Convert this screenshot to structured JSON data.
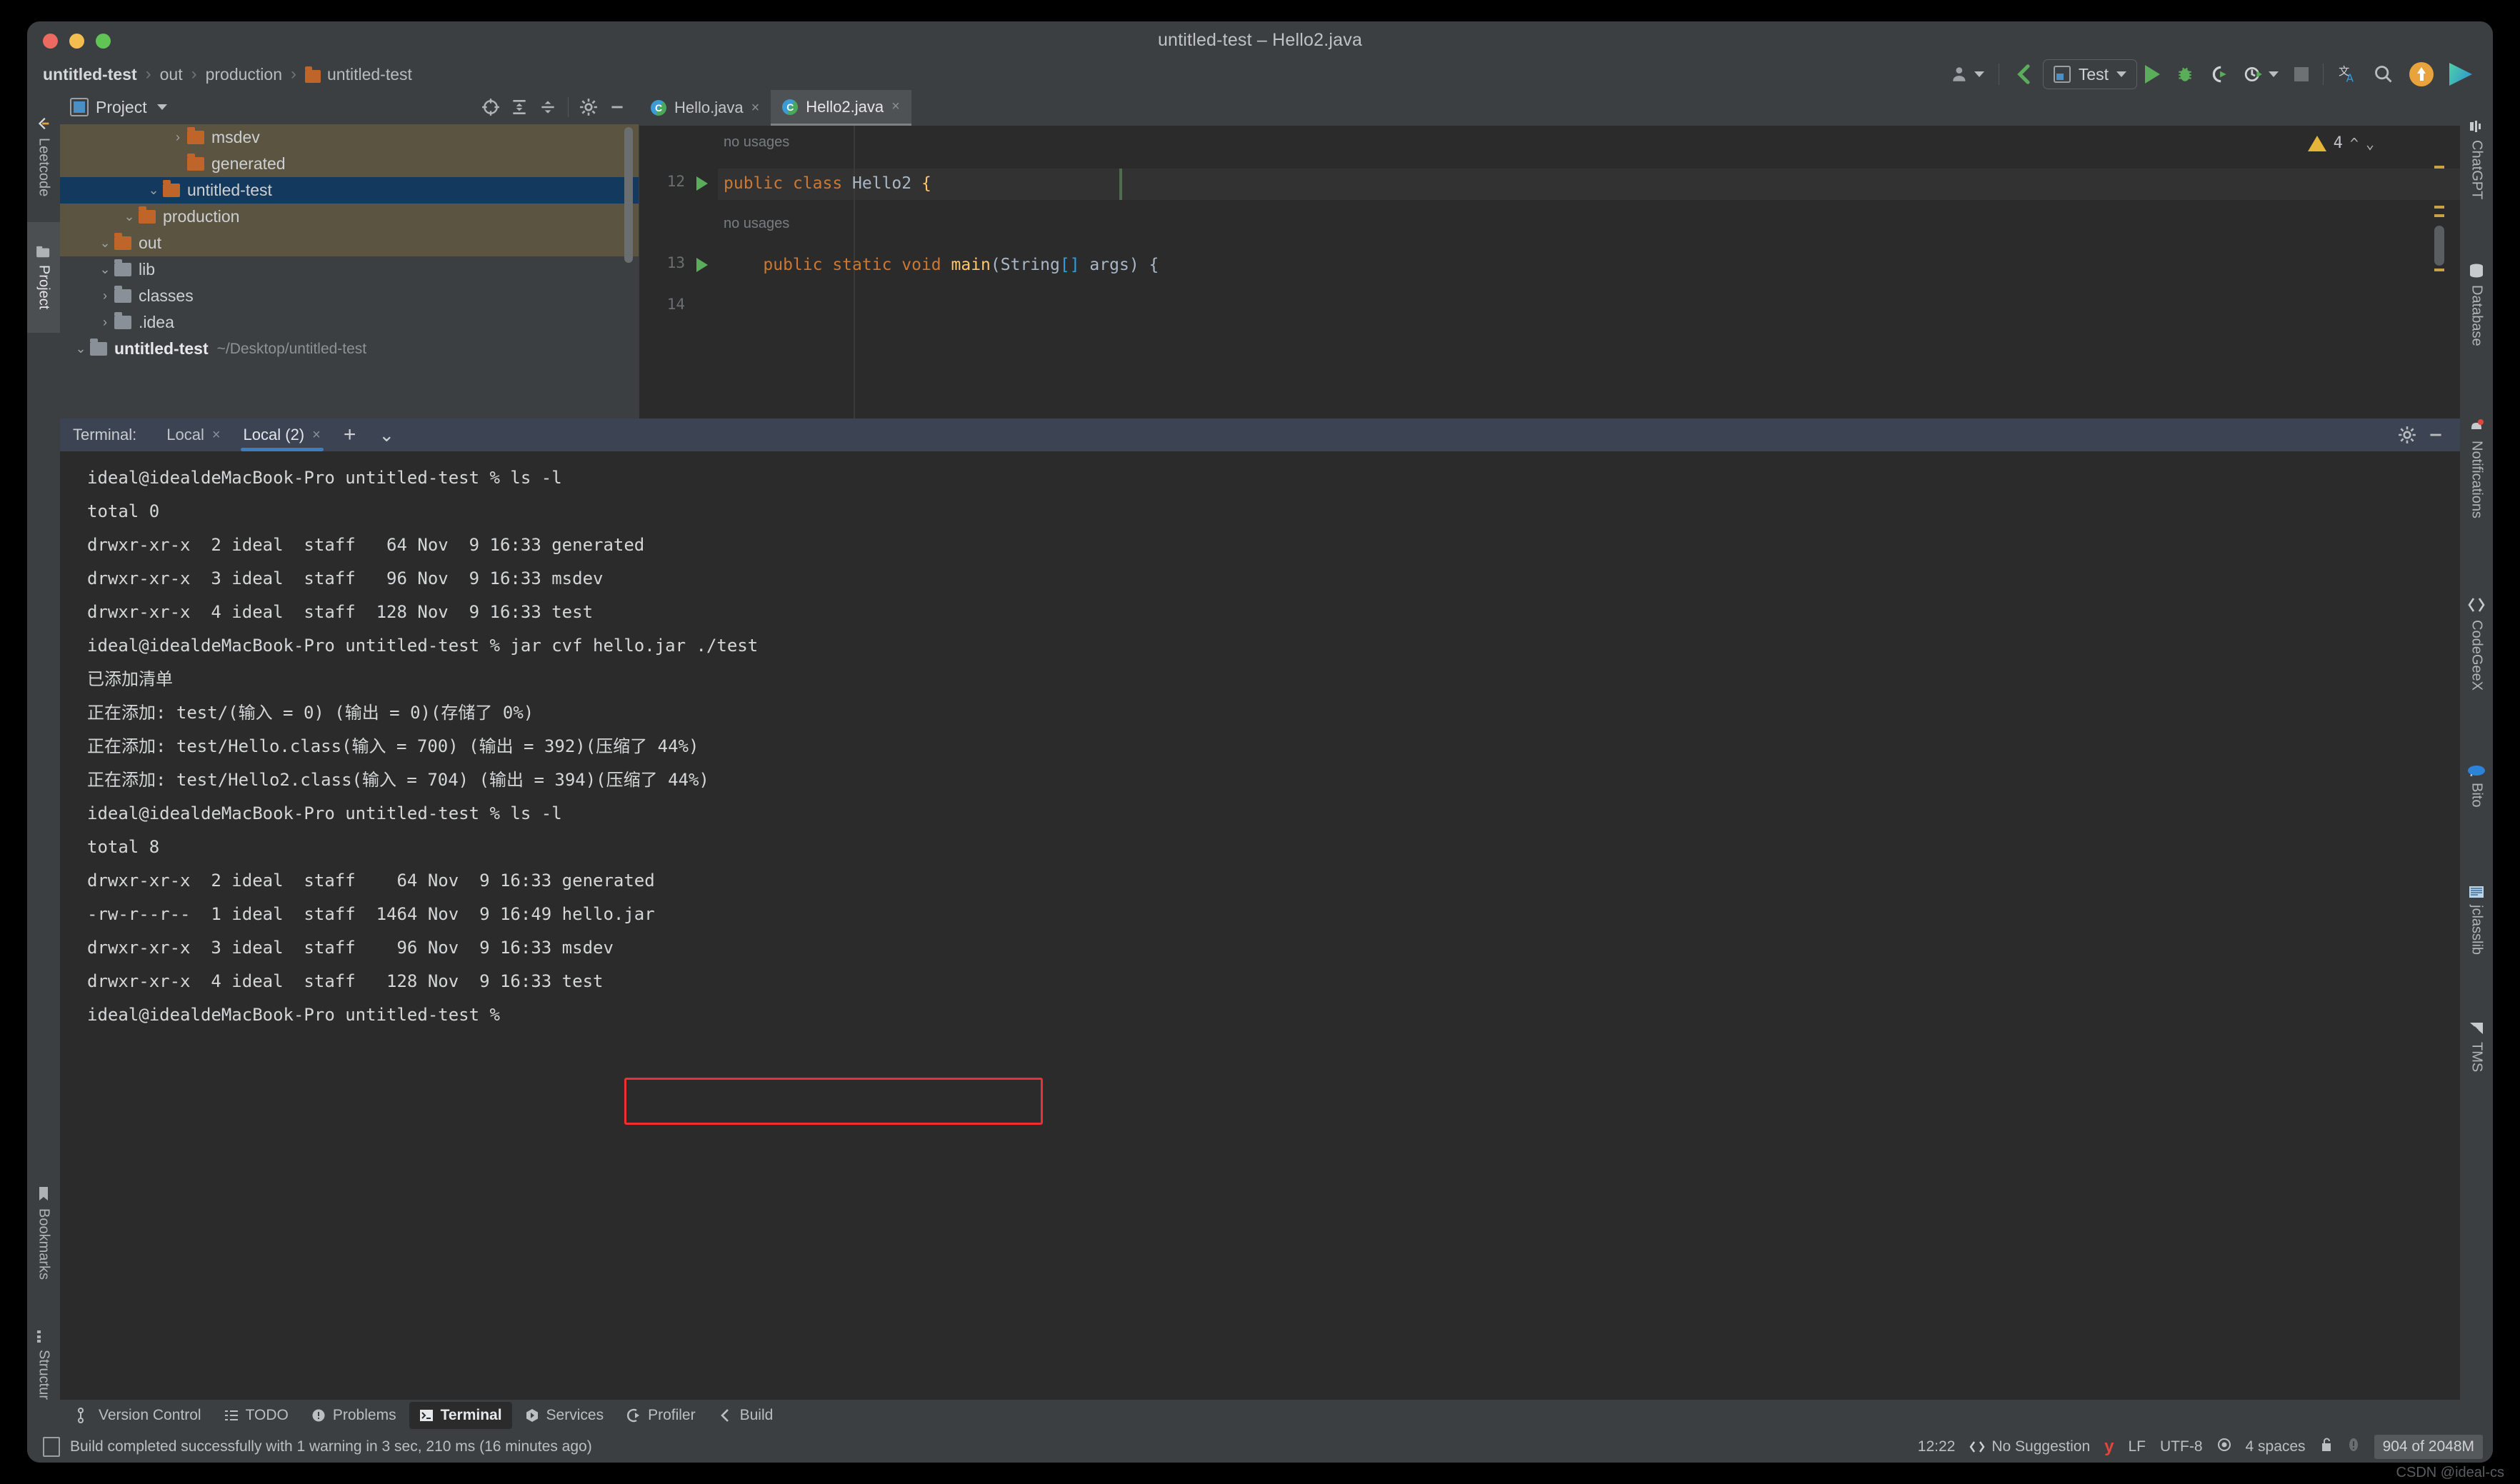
{
  "window": {
    "title": "untitled-test – Hello2.java"
  },
  "breadcrumb": {
    "items": [
      "untitled-test",
      "out",
      "production",
      "untitled-test"
    ],
    "separator": "›"
  },
  "toolbar": {
    "run_config_label": "Test",
    "icons": [
      "user-icon",
      "git-branch-icon",
      "run-icon",
      "debug-icon",
      "run-coverage-icon",
      "profile-icon",
      "stop-icon",
      "translate-icon",
      "search-icon",
      "update-icon",
      "app-logo-icon"
    ]
  },
  "left_strip": {
    "items": [
      {
        "label": "Leetcode",
        "selected": false
      },
      {
        "label": "Project",
        "selected": true
      },
      {
        "label": "Bookmarks",
        "selected": false
      },
      {
        "label": "Structure",
        "selected": false
      }
    ]
  },
  "right_strip": {
    "items": [
      {
        "label": "ChatGPT"
      },
      {
        "label": "Database"
      },
      {
        "label": "Notifications"
      },
      {
        "label": "CodeGeeX"
      },
      {
        "label": "Bito"
      },
      {
        "label": "jclasslib"
      },
      {
        "label": "TMS"
      }
    ]
  },
  "project_panel": {
    "title": "Project",
    "dropdown": "▾",
    "toolbar_icons": [
      "locate-icon",
      "expand-all-icon",
      "collapse-all-icon",
      "settings-gear-icon",
      "minimize-icon"
    ],
    "tree": [
      {
        "indent": 0,
        "twisty": "⌄",
        "name": "untitled-test",
        "path": "~/Desktop/untitled-test",
        "bold": true,
        "folder": "module",
        "highlight": "none"
      },
      {
        "indent": 1,
        "twisty": "›",
        "name": ".idea",
        "path": "",
        "bold": false,
        "folder": "gray",
        "highlight": "none"
      },
      {
        "indent": 1,
        "twisty": "›",
        "name": "classes",
        "path": "",
        "bold": false,
        "folder": "gray",
        "highlight": "none"
      },
      {
        "indent": 1,
        "twisty": "⌄",
        "name": "lib",
        "path": "",
        "bold": false,
        "folder": "gray",
        "highlight": "none"
      },
      {
        "indent": 1,
        "twisty": "⌄",
        "name": "out",
        "path": "",
        "bold": false,
        "folder": "orange",
        "highlight": "out"
      },
      {
        "indent": 2,
        "twisty": "⌄",
        "name": "production",
        "path": "",
        "bold": false,
        "folder": "orange",
        "highlight": "out"
      },
      {
        "indent": 3,
        "twisty": "⌄",
        "name": "untitled-test",
        "path": "",
        "bold": false,
        "folder": "orange",
        "highlight": "sel"
      },
      {
        "indent": 4,
        "twisty": "",
        "name": "generated",
        "path": "",
        "bold": false,
        "folder": "orange",
        "highlight": "out"
      },
      {
        "indent": 4,
        "twisty": "›",
        "name": "msdev",
        "path": "",
        "bold": false,
        "folder": "orange",
        "highlight": "out"
      }
    ]
  },
  "editor": {
    "tabs": [
      {
        "label": "Hello.java",
        "active": false
      },
      {
        "label": "Hello2.java",
        "active": true
      }
    ],
    "close_glyph": "×",
    "warning_count": "4",
    "lines": [
      {
        "number": "",
        "hint": "no usages",
        "type": "hint"
      },
      {
        "number": "12",
        "runnable": true,
        "tokens": [
          {
            "t": "public ",
            "c": "kw"
          },
          {
            "t": "class ",
            "c": "kw"
          },
          {
            "t": "Hello2 ",
            "c": "cls"
          },
          {
            "t": "{",
            "c": "br"
          }
        ]
      },
      {
        "number": "",
        "hint": "    no usages",
        "type": "hint"
      },
      {
        "number": "13",
        "runnable": true,
        "tokens": [
          {
            "t": "    public ",
            "c": "kw"
          },
          {
            "t": "static ",
            "c": "kw"
          },
          {
            "t": "void ",
            "c": "kw"
          },
          {
            "t": "main",
            "c": "mth"
          },
          {
            "t": "(",
            "c": "par"
          },
          {
            "t": "String",
            "c": "brg"
          },
          {
            "t": "[]",
            "c": "sq"
          },
          {
            "t": " args",
            "c": "brg"
          },
          {
            "t": ")",
            "c": "par"
          },
          {
            "t": " {",
            "c": "brg"
          }
        ]
      },
      {
        "number": "14",
        "runnable": false,
        "tokens": []
      }
    ]
  },
  "terminal": {
    "label": "Terminal:",
    "tabs": [
      {
        "label": "Local",
        "active": false
      },
      {
        "label": "Local (2)",
        "active": true
      }
    ],
    "add_glyph": "+",
    "dropdown_glyph": "⌄",
    "close_glyph": "×",
    "header_icons": [
      "settings-gear-icon",
      "minimize-icon"
    ],
    "lines": [
      "ideal@idealdeMacBook-Pro untitled-test % ls -l",
      "total 0",
      "drwxr-xr-x  2 ideal  staff   64 Nov  9 16:33 generated",
      "drwxr-xr-x  3 ideal  staff   96 Nov  9 16:33 msdev",
      "drwxr-xr-x  4 ideal  staff  128 Nov  9 16:33 test",
      "ideal@idealdeMacBook-Pro untitled-test % jar cvf hello.jar ./test",
      "已添加清单",
      "正在添加: test/(输入 = 0) (输出 = 0)(存储了 0%)",
      "正在添加: test/Hello.class(输入 = 700) (输出 = 392)(压缩了 44%)",
      "正在添加: test/Hello2.class(输入 = 704) (输出 = 394)(压缩了 44%)",
      "ideal@idealdeMacBook-Pro untitled-test % ls -l",
      "total 8",
      "drwxr-xr-x  2 ideal  staff    64 Nov  9 16:33 generated",
      "-rw-r--r--  1 ideal  staff  1464 Nov  9 16:49 hello.jar",
      "drwxr-xr-x  3 ideal  staff    96 Nov  9 16:33 msdev",
      "drwxr-xr-x  4 ideal  staff   128 Nov  9 16:33 test",
      "ideal@idealdeMacBook-Pro untitled-test %"
    ],
    "highlight_color": "#f03030"
  },
  "bottom_bar": {
    "items": [
      {
        "label": "Version Control",
        "icon": "branch-icon",
        "active": false
      },
      {
        "label": "TODO",
        "icon": "list-icon",
        "active": false
      },
      {
        "label": "Problems",
        "icon": "warning-circle-icon",
        "active": false
      },
      {
        "label": "Terminal",
        "icon": "terminal-icon",
        "active": true
      },
      {
        "label": "Services",
        "icon": "services-icon",
        "active": false
      },
      {
        "label": "Profiler",
        "icon": "profiler-icon",
        "active": false
      },
      {
        "label": "Build",
        "icon": "build-hammer-icon",
        "active": false
      }
    ]
  },
  "status_bar": {
    "message": "Build completed successfully with 1 warning in 3 sec, 210 ms (16 minutes ago)",
    "time": "12:22",
    "suggestion": "No Suggestion",
    "line_sep": "LF",
    "encoding": "UTF-8",
    "indent": "4 spaces",
    "memory": "904 of 2048M"
  },
  "watermark": "CSDN @ideal-cs"
}
